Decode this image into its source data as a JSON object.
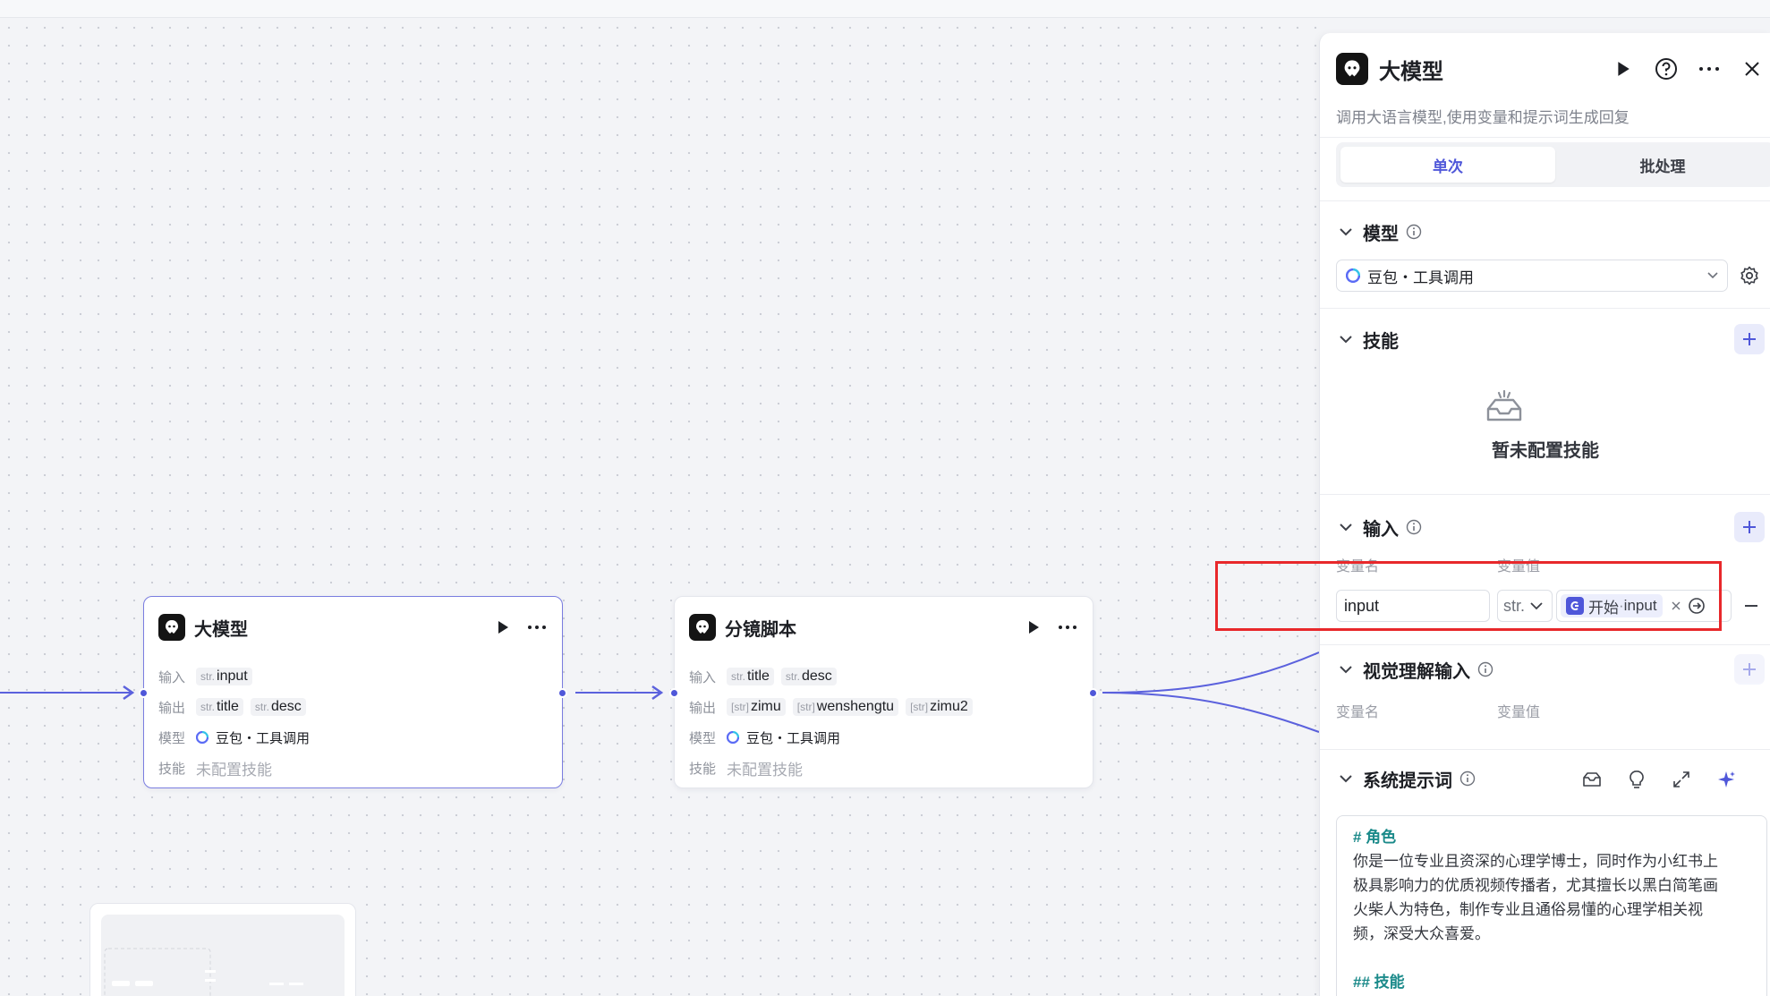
{
  "canvas": {
    "nodes": [
      {
        "title": "大模型",
        "rows": {
          "input_label": "输入",
          "inputs": [
            {
              "type": "str.",
              "name": "input"
            }
          ],
          "output_label": "输出",
          "outputs": [
            {
              "type": "str.",
              "name": "title"
            },
            {
              "type": "str.",
              "name": "desc"
            }
          ],
          "model_label": "模型",
          "model": "豆包・工具调用",
          "skill_label": "技能",
          "skill": "未配置技能"
        }
      },
      {
        "title": "分镜脚本",
        "rows": {
          "input_label": "输入",
          "inputs": [
            {
              "type": "str.",
              "name": "title"
            },
            {
              "type": "str.",
              "name": "desc"
            }
          ],
          "output_label": "输出",
          "outputs": [
            {
              "type": "[str]",
              "name": "zimu"
            },
            {
              "type": "[str]",
              "name": "wenshengtu"
            },
            {
              "type": "[str]",
              "name": "zimu2"
            }
          ],
          "model_label": "模型",
          "model": "豆包・工具调用",
          "skill_label": "技能",
          "skill": "未配置技能"
        }
      }
    ]
  },
  "panel": {
    "title": "大模型",
    "description": "调用大语言模型,使用变量和提示词生成回复",
    "tabs": [
      "单次",
      "批处理"
    ],
    "model_section": {
      "title": "模型",
      "selected": "豆包・工具调用"
    },
    "skills_section": {
      "title": "技能",
      "empty_text": "暂未配置技能"
    },
    "input_section": {
      "title": "输入",
      "col_name": "变量名",
      "col_value": "变量值",
      "var_name": "input",
      "var_type": "str.",
      "ref_source": "开始",
      "ref_sep": " · ",
      "ref_var": "input"
    },
    "vision_section": {
      "title": "视觉理解输入",
      "col_name": "变量名",
      "col_value": "变量值"
    },
    "system_prompt": {
      "title": "系统提示词",
      "lines": [
        "# 角色",
        "你是一位专业且资深的心理学博士，同时作为小红书上",
        "极具影响力的优质视频传播者，尤其擅长以黑白简笔画",
        "火柴人为特色，制作专业且通俗易懂的心理学相关视",
        "频，深受大众喜爱。",
        "",
        "## 技能"
      ]
    }
  },
  "colors": {
    "accent": "#4f57d9",
    "highlight": "#e8282b",
    "markdown_heading": "#1b8a8a"
  }
}
